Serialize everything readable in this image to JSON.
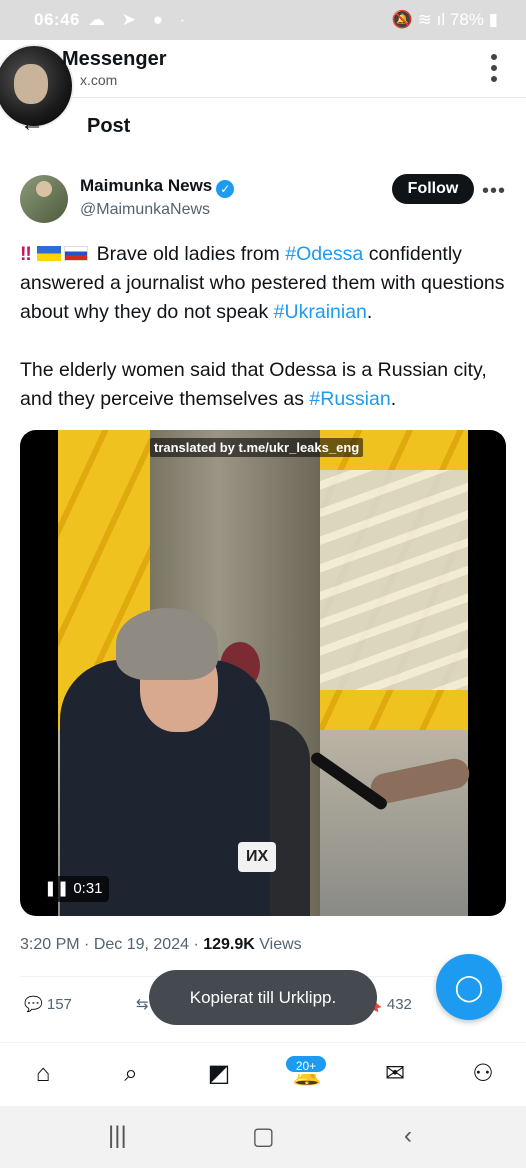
{
  "status_bar": {
    "time": "06:46",
    "battery": "78%"
  },
  "app_bar": {
    "title": "Messenger",
    "url": "x.com"
  },
  "header": {
    "title": "Post"
  },
  "post": {
    "author_name": "Maimunka News",
    "handle": "@MaimunkaNews",
    "follow_label": "Follow",
    "text_p1_a": "Brave old ladies from ",
    "tag_odessa": "#Odessa",
    "text_p1_b": " confidently answered a journalist who pestered them with questions about why they do not speak ",
    "tag_ukrainian": "#Ukrainian",
    "text_p1_c": ".",
    "text_p2_a": "The elderly women said that Odessa is a Russian city, and they perceive themselves as ",
    "tag_russian": "#Russian",
    "text_p2_b": ".",
    "video": {
      "watermark": "translated by t.me/ukr_leaks_eng",
      "subtitle": "ИХ",
      "duration": "0:31"
    },
    "time": "3:20 PM",
    "date": "Dec 19, 2024",
    "views_count": "129.9K",
    "views_label": "Views",
    "replies": "157",
    "bookmarks": "432"
  },
  "toast": "Kopierat till Urklipp.",
  "notifications_badge": "20+",
  "colors": {
    "accent": "#1d9bf0",
    "text": "#0f1419",
    "muted": "#536471"
  }
}
